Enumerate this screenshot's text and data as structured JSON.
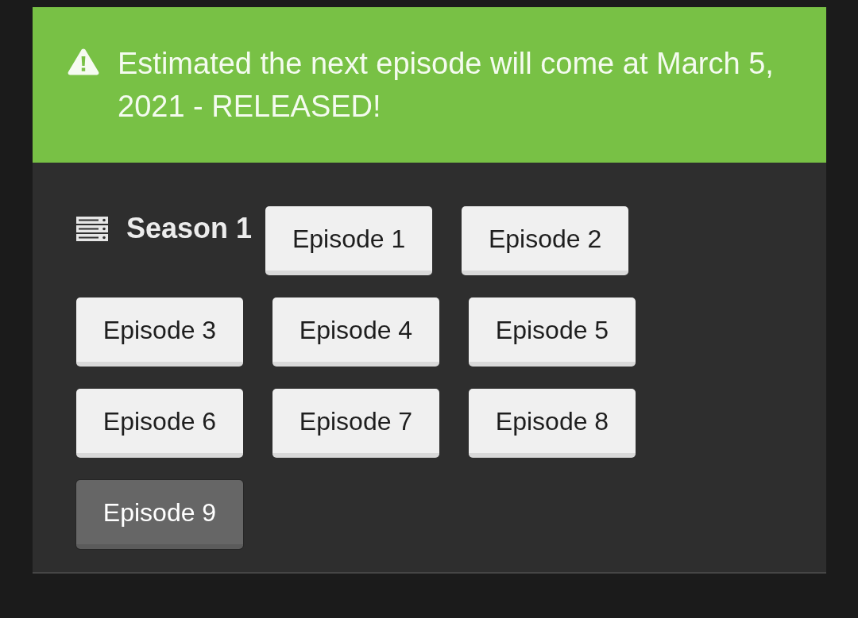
{
  "alert": {
    "text": "Estimated the next episode will come at March 5, 2021 - RELEASED!"
  },
  "season": {
    "title": "Season 1",
    "episodes": [
      {
        "label": "Episode 1",
        "selected": false
      },
      {
        "label": "Episode 2",
        "selected": false
      },
      {
        "label": "Episode 3",
        "selected": false
      },
      {
        "label": "Episode 4",
        "selected": false
      },
      {
        "label": "Episode 5",
        "selected": false
      },
      {
        "label": "Episode 6",
        "selected": false
      },
      {
        "label": "Episode 7",
        "selected": false
      },
      {
        "label": "Episode 8",
        "selected": false
      },
      {
        "label": "Episode 9",
        "selected": true
      }
    ]
  }
}
